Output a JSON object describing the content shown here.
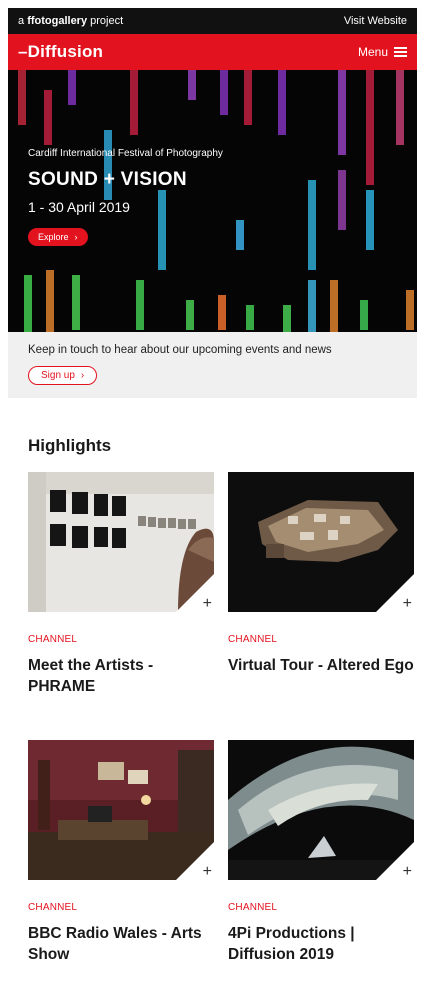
{
  "topbar": {
    "brand": "ffotogallery",
    "brand_prefix": "a",
    "brand_suffix": "project",
    "visit": "Visit Website"
  },
  "nav": {
    "logo": "–Diffusion",
    "menu": "Menu"
  },
  "hero": {
    "subtitle": "Cardiff International Festival of Photography",
    "title": "SOUND + VISION",
    "dates": "1 - 30 April 2019",
    "button": "Explore"
  },
  "newsletter": {
    "text": "Keep in touch to hear about our upcoming events and news",
    "button": "Sign up"
  },
  "highlights": {
    "heading": "Highlights",
    "cards": [
      {
        "category": "CHANNEL",
        "title": "Meet the Artists - PHRAME"
      },
      {
        "category": "CHANNEL",
        "title": "Virtual Tour - Altered Ego"
      },
      {
        "category": "CHANNEL",
        "title": "BBC Radio Wales - Arts Show"
      },
      {
        "category": "CHANNEL",
        "title": "4Pi Productions | Diffusion 2019"
      }
    ]
  },
  "colors": {
    "brand_red": "#e3121f",
    "topbar": "#111111"
  }
}
